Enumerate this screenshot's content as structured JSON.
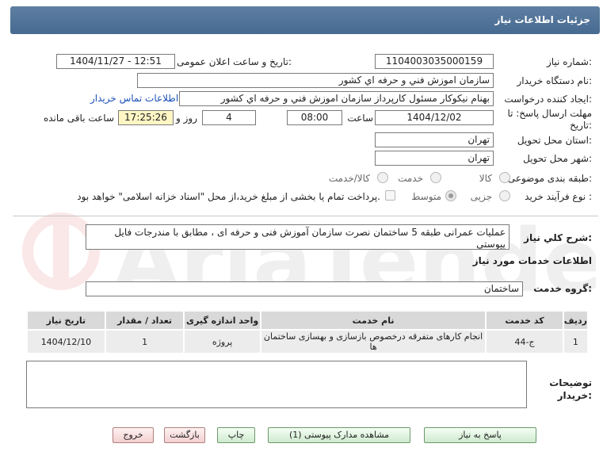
{
  "header": {
    "title": "جزئیات اطلاعات نیاز"
  },
  "labels": {
    "need_number": "شماره نیاز:",
    "announce_datetime": "تاریخ و ساعت اعلان عمومی:",
    "buyer_org": "نام دستگاه خریدار:",
    "requester": "ایجاد کننده درخواست:",
    "deadline": "مهلت ارسال پاسخ: تا تاریخ:",
    "deadline_time": "ساعت",
    "days_and": "روز و",
    "remaining": "ساعت باقی مانده",
    "province": "استان محل تحویل:",
    "city": "شهر محل تحویل:",
    "category": "طبقه بندی موضوعی:",
    "process_type": "نوع فرآیند خرید :",
    "general_desc": "شرح کلي نياز:",
    "services_info": "اطلاعات خدمات مورد نیاز",
    "service_group": "گروه خدمت:",
    "buyer_notes": "توضیحات خریدار:"
  },
  "values": {
    "need_number": "1104003035000159",
    "announce_datetime": "1404/11/27 - 12:51",
    "buyer_org": "سازمان اموزش فني و حرفه اي كشور",
    "requester": "بهنام نیکوکار مسئول کارپرداز سازمان اموزش فني و حرفه اي كشور",
    "contact_link": "اطلاعات تماس خریدار",
    "deadline_date": "1404/12/02",
    "deadline_time": "08:00",
    "days": "4",
    "remaining_time": "17:25:26",
    "province": "تهران",
    "city": "تهران",
    "general_desc": "عملیات عمرانی طبقه 5 ساختمان نصرت سازمان آموزش فنی و حرفه ای ، مطابق با مندرجات فایل پیوستی",
    "service_group": "ساختمان",
    "buyer_notes": ""
  },
  "category_options": [
    {
      "label": "کالا",
      "selected": false
    },
    {
      "label": "خدمت",
      "selected": false
    },
    {
      "label": "کالا/خدمت",
      "selected": false
    }
  ],
  "process_options": [
    {
      "label": "جزیی",
      "selected": false
    },
    {
      "label": "متوسط",
      "selected": true
    }
  ],
  "payment_note": "پرداخت تمام یا بخشی از مبلغ خرید،از محل \"اسناد خزانه اسلامی\" خواهد بود.",
  "table": {
    "headers": [
      "ردیف",
      "کد خدمت",
      "نام خدمت",
      "واحد اندازه گیری",
      "تعداد / مقدار",
      "تاریخ نیاز"
    ],
    "rows": [
      [
        "1",
        "ج-44",
        "انجام کارهای متفرقه درخصوص بازسازی و بهسازی ساختمان ها",
        "پروژه",
        "1",
        "1404/12/10"
      ]
    ]
  },
  "buttons": {
    "reply": "پاسخ به نیاز",
    "view_docs": "مشاهده مدارک پیوستی (1)",
    "print": "چاپ",
    "back": "بازگشت",
    "exit": "خروج"
  },
  "watermark": "AriaTender.net"
}
